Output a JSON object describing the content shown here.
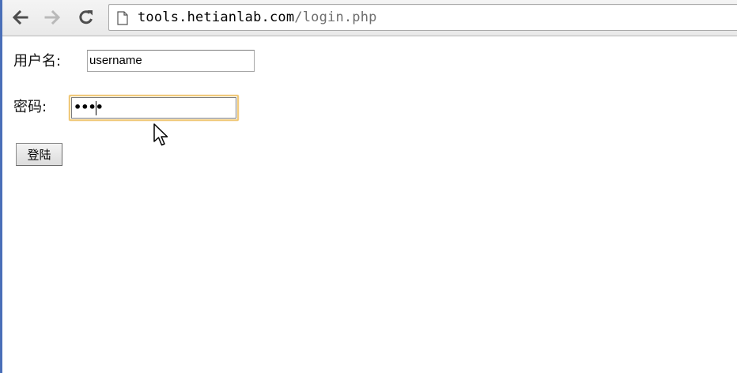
{
  "browser": {
    "url_host": "tools.hetianlab.com",
    "url_path": "/login.php"
  },
  "form": {
    "username_label": "用户名:",
    "username_value": "username",
    "password_label": "密码:",
    "password_mask": "••••",
    "submit_label": "登陆"
  },
  "icons": {
    "back": "back-arrow-icon",
    "forward": "forward-arrow-icon",
    "reload": "reload-icon",
    "page": "page-icon",
    "cursor": "mouse-cursor-icon"
  },
  "colors": {
    "focus_ring": "#f0c97a",
    "window_edge": "#4a6fb8"
  }
}
